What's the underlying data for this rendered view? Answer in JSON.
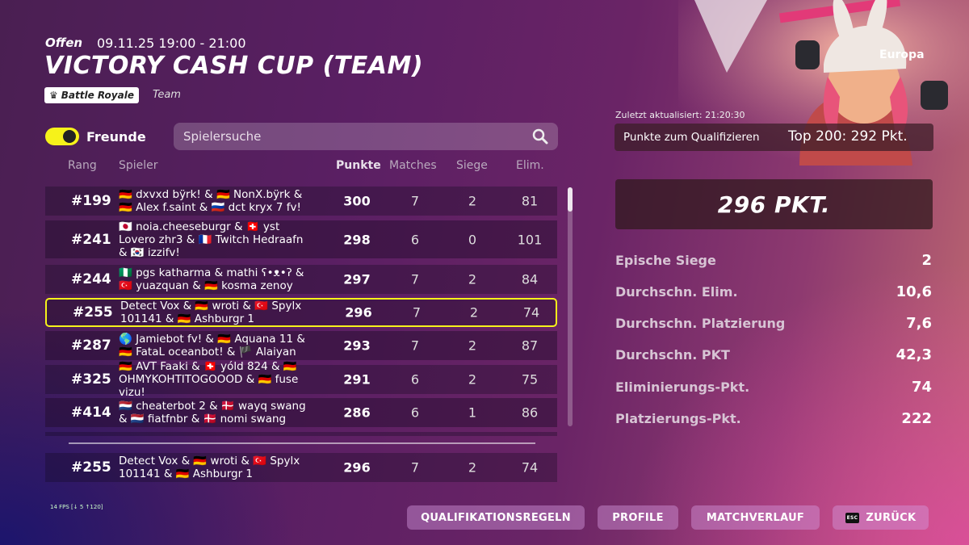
{
  "header": {
    "status": "Offen",
    "datetime": "09.11.25 19:00 - 21:00",
    "title": "VICTORY CASH CUP (TEAM)",
    "mode_badge": "Battle Royale",
    "team_label": "Team"
  },
  "friends_toggle": {
    "label": "Freunde",
    "state": "on"
  },
  "search": {
    "placeholder": "Spielersuche"
  },
  "columns": {
    "rank": "Rang",
    "player": "Spieler",
    "points": "Punkte",
    "matches": "Matches",
    "wins": "Siege",
    "elims": "Elim."
  },
  "rows": [
    {
      "rank": "#199",
      "players": "🇩🇪 dxvxd bÿrk! & 🇩🇪 NonX.bÿrk & 🇩🇪 Alex f.saint & 🇷🇺 dct kryx 7 fv!",
      "points": "300",
      "matches": "7",
      "wins": "2",
      "elims": "81"
    },
    {
      "rank": "#241",
      "players": "🇯🇵 noia.cheeseburgr & 🇨🇭 yst Lovero zhr3 & 🇫🇷 Twitch Hedraafn & 🇰🇷 izzifv!",
      "points": "298",
      "matches": "6",
      "wins": "0",
      "elims": "101"
    },
    {
      "rank": "#244",
      "players": "🇳🇬 pgs katharma & mathi ʕ•ᴥ•ʔ & 🇹🇷 yuazquan & 🇩🇪 kosma zenoy",
      "points": "297",
      "matches": "7",
      "wins": "2",
      "elims": "84"
    },
    {
      "rank": "#255",
      "players": "Detect Vox & 🇩🇪 wroti & 🇹🇷 Spylx 101141 & 🇩🇪 Ashburgr 1",
      "points": "296",
      "matches": "7",
      "wins": "2",
      "elims": "74",
      "highlight": true
    },
    {
      "rank": "#287",
      "players": "🌎 Jamiebot fv! & 🇩🇪 Aquana 11 & 🇩🇪 FataL oceanbot! & 🏴 Alaiyan",
      "points": "293",
      "matches": "7",
      "wins": "2",
      "elims": "87"
    },
    {
      "rank": "#325",
      "players": "🇩🇪 AVT Faaki & 🇨🇭 yóld 824 & 🇩🇪 OHMYKOHTITOGOOOD & 🇩🇪 fuse vizu!",
      "points": "291",
      "matches": "6",
      "wins": "2",
      "elims": "75"
    },
    {
      "rank": "#414",
      "players": "🇳🇱 cheaterbot 2 & 🇩🇰 wayq swang & 🇳🇱 fiatfnbr & 🇩🇰 nomi swang",
      "points": "286",
      "matches": "6",
      "wins": "1",
      "elims": "86"
    }
  ],
  "own_row": {
    "rank": "#255",
    "players": "Detect Vox & 🇩🇪 wroti & 🇹🇷 Spylx 101141 & 🇩🇪 Ashburgr 1",
    "points": "296",
    "matches": "7",
    "wins": "2",
    "elims": "74"
  },
  "panel": {
    "region": "Europa",
    "updated": "Zuletzt aktualisiert: 21:20:30",
    "qualify_label": "Punkte zum Qualifizieren",
    "qualify_value": "Top 200: 292 Pkt.",
    "score": "296 PKT.",
    "stats": [
      {
        "label": "Epische Siege",
        "value": "2"
      },
      {
        "label": "Durchschn. Elim.",
        "value": "10,6"
      },
      {
        "label": "Durchschn. Platzierung",
        "value": "7,6"
      },
      {
        "label": "Durchschn. PKT",
        "value": "42,3"
      },
      {
        "label": "Eliminierungs-Pkt.",
        "value": "74"
      },
      {
        "label": "Platzierungs-Pkt.",
        "value": "222"
      }
    ]
  },
  "buttons": {
    "rules": "QUALIFIKATIONSREGELN",
    "profile": "PROFILE",
    "history": "MATCHVERLAUF",
    "back": "ZURÜCK",
    "back_key": "ESC"
  },
  "fps": "14 FPS [↓ 5 ↑120]",
  "colors": {
    "accent": "#f6f21a"
  }
}
